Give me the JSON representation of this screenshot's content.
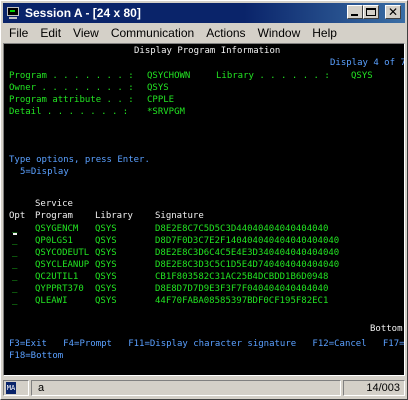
{
  "window": {
    "title": "Session A - [24 x 80]",
    "controls": {
      "minimize": "_",
      "maximize": "□",
      "close": "×"
    }
  },
  "menu": {
    "file": "File",
    "edit": "Edit",
    "view": "View",
    "communication": "Communication",
    "actions": "Actions",
    "window": "Window",
    "help": "Help"
  },
  "terminal": {
    "screen_title": "Display Program Information",
    "display_indicator": "Display 4 of 7",
    "program_label": "Program . . . . . . . :",
    "program_value": "QSYCHOWN",
    "library_label": "Library . . . . . . :",
    "library_value": "QSYS",
    "owner_label": "Owner . . . . . . . . :",
    "owner_value": "QSYS",
    "attribute_label": "Program attribute . . :",
    "attribute_value": "CPPLE",
    "detail_label": "Detail . . . . . . . :",
    "detail_value": "*SRVPGM",
    "instructions": "Type options, press Enter.",
    "option_legend": "5=Display",
    "col_service": "Service",
    "col_opt": "Opt",
    "col_program": "Program",
    "col_library": "Library",
    "col_signature": "Signature",
    "rows": [
      {
        "opt": "_",
        "program": "QSYGENCM",
        "library": "QSYS",
        "signature": "D8E2E8C7C5D5C3D44040404040404040"
      },
      {
        "opt": "_",
        "program": "QP0LGS1",
        "library": "QSYS",
        "signature": "D8D7F0D3C7E2F140404040404040404040"
      },
      {
        "opt": "_",
        "program": "QSYCODEUTL",
        "library": "QSYS",
        "signature": "D8E2E8C3D6C4C5E4E3D340404040404040"
      },
      {
        "opt": "_",
        "program": "QSYCLEANUP",
        "library": "QSYS",
        "signature": "D8E2E8C3D3C5C1D5E4D740404040404040"
      },
      {
        "opt": "_",
        "program": "QC2UTIL1",
        "library": "QSYS",
        "signature": "CB1F803582C31AC25B4DCBDD1B6D0948"
      },
      {
        "opt": "_",
        "program": "QYPPRT370",
        "library": "QSYS",
        "signature": "D8E8D7D7D9E3F3F7F040404040404040"
      },
      {
        "opt": "_",
        "program": "QLEAWI",
        "library": "QSYS",
        "signature": "44F70FABA08585397BDF0CF195F82EC1"
      }
    ],
    "more_indicator": "Bottom",
    "fkeys_line1": "F3=Exit   F4=Prompt   F11=Display character signature   F12=Cancel   F17=Top",
    "fkeys_line2": "F18=Bottom"
  },
  "status": {
    "badge": "MA",
    "session_letter": "a",
    "cursor_position": "14/003"
  }
}
